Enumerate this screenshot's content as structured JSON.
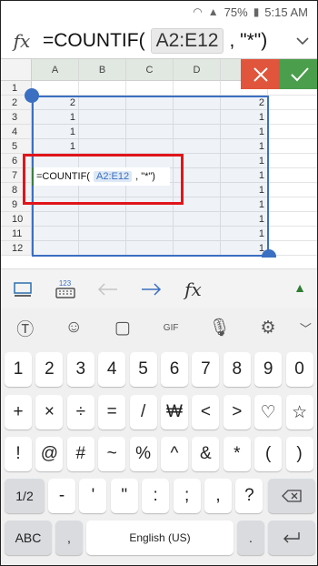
{
  "status_bar": {
    "signal": "▲",
    "battery_percent": "75%",
    "time": "5:15 AM"
  },
  "formula_bar": {
    "fx_label": "fx",
    "formula_prefix": "=COUNTIF(",
    "formula_range": "A2:E12",
    "formula_suffix": ", \"*\")",
    "expand_icon": "chevron-down-icon"
  },
  "grid": {
    "columns": [
      "A",
      "B",
      "C",
      "D",
      "E"
    ],
    "rows": [
      "1",
      "2",
      "3",
      "4",
      "5",
      "6",
      "7",
      "8",
      "9",
      "10",
      "11",
      "12"
    ],
    "col_a_values": {
      "2": "2",
      "3": "1",
      "4": "1",
      "5": "1"
    },
    "col_e_values": {
      "2": "2",
      "3": "1",
      "4": "1",
      "5": "1",
      "6": "1",
      "7": "1",
      "8": "1",
      "9": "1",
      "10": "1",
      "11": "1",
      "12": "1"
    }
  },
  "cell_editor": {
    "prefix": "=COUNTIF(",
    "range": "A2:E12",
    "suffix": ", \"*\")"
  },
  "actions": {
    "cancel_icon": "close-icon",
    "confirm_icon": "checkmark-icon"
  },
  "toolbar": {
    "keyboard_toggle_icon": "monitor-icon",
    "numeric_keyboard_icon": "keypad-123-icon",
    "numeric_label": "123",
    "back_arrow_icon": "arrow-left-icon",
    "forward_arrow_icon": "arrow-right-icon",
    "function_label": "fx",
    "collapse_icon": "triangle-up-icon"
  },
  "keyboard": {
    "row1": [
      "1",
      "2",
      "3",
      "4",
      "5",
      "6",
      "7",
      "8",
      "9",
      "0"
    ],
    "row2": [
      "+",
      "×",
      "÷",
      "=",
      "/",
      "₩",
      "<",
      ">",
      "♡",
      "☆"
    ],
    "row3": [
      "!",
      "@",
      "#",
      "~",
      "%",
      "^",
      "&",
      "*",
      "(",
      ")"
    ],
    "row4_left": "1/2",
    "row4": [
      "-",
      "'",
      "\"",
      ":",
      ";",
      ",",
      "?"
    ],
    "row5_left": "ABC",
    "row5_space": "English (US)",
    "row5_comma": ",",
    "row5_period": "."
  },
  "colors": {
    "accent_blue": "#3b6fc2",
    "cancel_red": "#e0553b",
    "confirm_green": "#4a9e4c",
    "annotation_red": "#e0151b"
  }
}
